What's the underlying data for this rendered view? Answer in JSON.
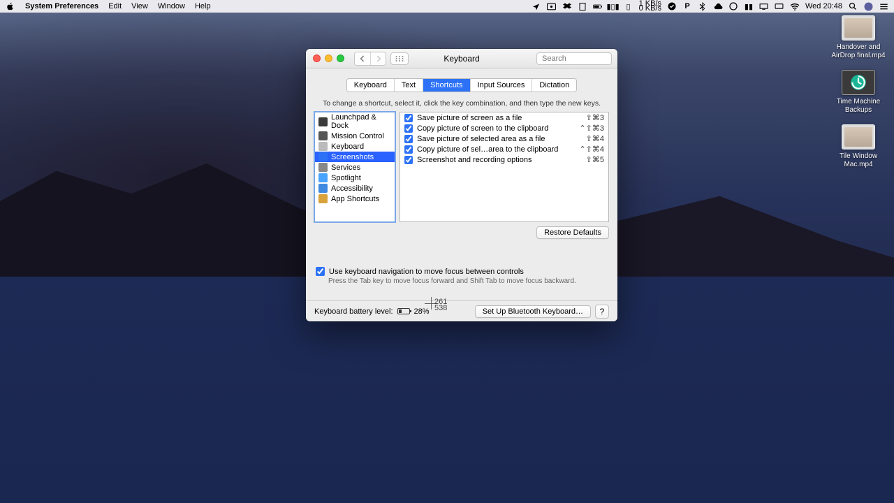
{
  "menubar": {
    "app_name": "System Preferences",
    "menus": [
      "Edit",
      "View",
      "Window",
      "Help"
    ],
    "clock": "Wed 20:48",
    "net_up": "1 KB/s",
    "net_down": "0 KB/s"
  },
  "desktop": {
    "icons": [
      {
        "label": "Handover and AirDrop final.mp4",
        "kind": "video"
      },
      {
        "label": "Time Machine Backups",
        "kind": "tm"
      },
      {
        "label": "Tile Window Mac.mp4",
        "kind": "video"
      }
    ]
  },
  "window": {
    "title": "Keyboard",
    "search_placeholder": "Search",
    "tabs": [
      {
        "label": "Keyboard",
        "active": false
      },
      {
        "label": "Text",
        "active": false
      },
      {
        "label": "Shortcuts",
        "active": true
      },
      {
        "label": "Input Sources",
        "active": false
      },
      {
        "label": "Dictation",
        "active": false
      }
    ],
    "instruction": "To change a shortcut, select it, click the key combination, and then type the new keys.",
    "categories": [
      {
        "label": "Launchpad & Dock",
        "icon": "#3a3a3a",
        "selected": false
      },
      {
        "label": "Mission Control",
        "icon": "#555",
        "selected": false
      },
      {
        "label": "Keyboard",
        "icon": "#bbb",
        "selected": false
      },
      {
        "label": "Screenshots",
        "icon": "#2d72f6",
        "selected": true
      },
      {
        "label": "Services",
        "icon": "#888",
        "selected": false
      },
      {
        "label": "Spotlight",
        "icon": "#4aa3ff",
        "selected": false
      },
      {
        "label": "Accessibility",
        "icon": "#3f8ae0",
        "selected": false
      },
      {
        "label": "App Shortcuts",
        "icon": "#d9a23a",
        "selected": false
      }
    ],
    "shortcuts": [
      {
        "checked": true,
        "label": "Save picture of screen as a file",
        "keys": "⇧⌘3"
      },
      {
        "checked": true,
        "label": "Copy picture of screen to the clipboard",
        "keys": "⌃⇧⌘3"
      },
      {
        "checked": true,
        "label": "Save picture of selected area as a file",
        "keys": "⇧⌘4"
      },
      {
        "checked": true,
        "label": "Copy picture of sel…area to the clipboard",
        "keys": "⌃⇧⌘4"
      },
      {
        "checked": true,
        "label": "Screenshot and recording options",
        "keys": "⇧⌘5"
      }
    ],
    "restore_label": "Restore Defaults",
    "kbnav_checked": true,
    "kbnav_label": "Use keyboard navigation to move focus between controls",
    "kbnav_sub": "Press the Tab key to move focus forward and Shift Tab to move focus backward.",
    "battery_label": "Keyboard battery level:",
    "battery_pct": "28%",
    "bluetooth_btn": "Set Up Bluetooth Keyboard…",
    "help": "?"
  },
  "crosshair": {
    "x": "261",
    "y": "538"
  }
}
